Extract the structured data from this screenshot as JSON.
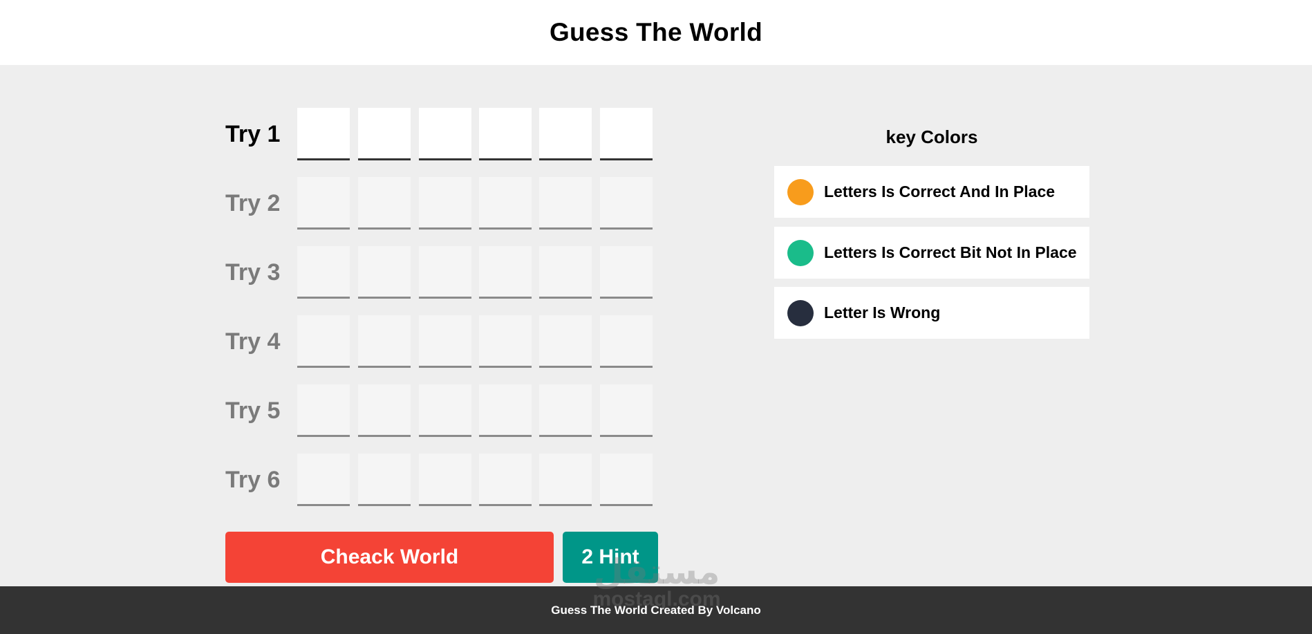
{
  "header": {
    "title": "Guess The World"
  },
  "game": {
    "tries": [
      {
        "label": "Try 1",
        "active": true
      },
      {
        "label": "Try 2",
        "active": false
      },
      {
        "label": "Try 3",
        "active": false
      },
      {
        "label": "Try 4",
        "active": false
      },
      {
        "label": "Try 5",
        "active": false
      },
      {
        "label": "Try 6",
        "active": false
      }
    ],
    "letters_per_try": 6
  },
  "buttons": {
    "check_label": "Cheack World",
    "hint_label": "2 Hint"
  },
  "key_colors": {
    "title": "key Colors",
    "items": [
      {
        "label": "Letters Is Correct And In Place",
        "color": "#f89c1c"
      },
      {
        "label": "Letters Is Correct Bit Not In Place",
        "color": "#1abc8a"
      },
      {
        "label": "Letter Is Wrong",
        "color": "#272e3e"
      }
    ]
  },
  "watermark": {
    "arabic": "مستقل",
    "latin": "mostaql.com"
  },
  "footer": {
    "text": "Guess The World Created By Volcano"
  },
  "colors": {
    "header_bg": "#ffffff",
    "page_bg": "#eeeeee",
    "check_button": "#f44336",
    "hint_button": "#009688",
    "footer_bg": "#333333"
  }
}
